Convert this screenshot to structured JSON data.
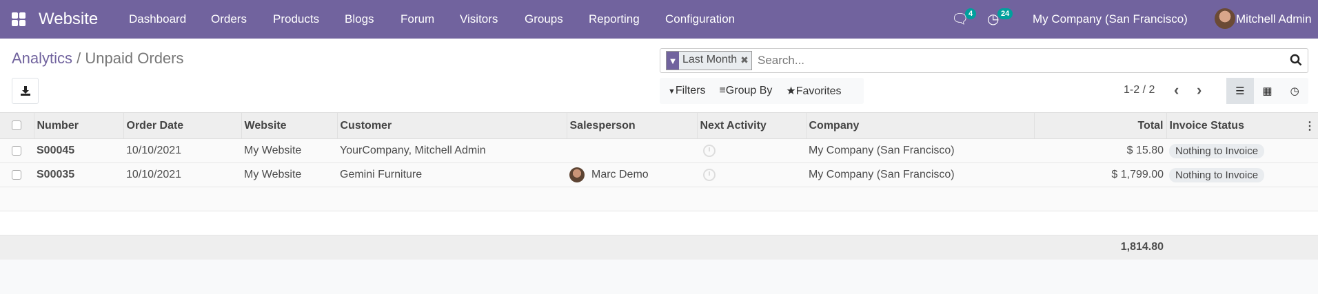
{
  "navbar": {
    "app_name": "Website",
    "menu": [
      "Dashboard",
      "Orders",
      "Products",
      "Blogs",
      "Forum",
      "Visitors",
      "Groups",
      "Reporting",
      "Configuration"
    ],
    "messages_count": "4",
    "activities_count": "24",
    "company": "My Company (San Francisco)",
    "user": "Mitchell Admin",
    "color": "#71639e"
  },
  "breadcrumb": {
    "parent": "Analytics",
    "separator": "/",
    "current": "Unpaid Orders"
  },
  "search": {
    "facet": "Last Month",
    "placeholder": "Search..."
  },
  "filters": {
    "filters": "Filters",
    "group_by": "Group By",
    "favorites": "Favorites"
  },
  "pager": {
    "text": "1-2 / 2"
  },
  "table": {
    "headers": [
      "Number",
      "Order Date",
      "Website",
      "Customer",
      "Salesperson",
      "Next Activity",
      "Company",
      "Total",
      "Invoice Status"
    ],
    "rows": [
      {
        "number": "S00045",
        "date": "10/10/2021",
        "website": "My Website",
        "customer": "YourCompany, Mitchell Admin",
        "salesperson": "",
        "company": "My Company (San Francisco)",
        "total": "$ 15.80",
        "status": "Nothing to Invoice"
      },
      {
        "number": "S00035",
        "date": "10/10/2021",
        "website": "My Website",
        "customer": "Gemini Furniture",
        "salesperson": "Marc Demo",
        "company": "My Company (San Francisco)",
        "total": "$ 1,799.00",
        "status": "Nothing to Invoice"
      }
    ],
    "footer_total": "1,814.80"
  }
}
